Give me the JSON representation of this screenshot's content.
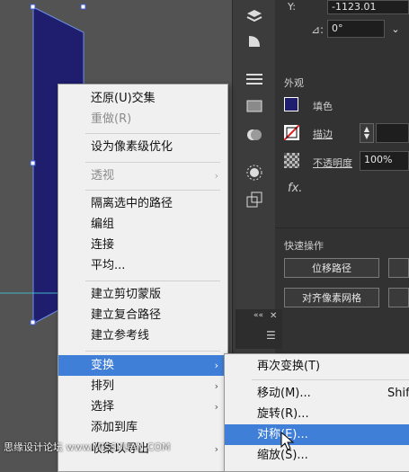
{
  "colors": {
    "menu_highlight": "#3f7fd8",
    "shape_fill": "#1f1d6e",
    "selection": "#6e8fe6"
  },
  "props": {
    "y_label": "Y:",
    "y_value": "-1123.01",
    "angle_value": "0°",
    "appearance_title": "外观",
    "fill_label": "填色",
    "stroke_label": "描边",
    "opacity_label": "不透明度",
    "opacity_value": "100%",
    "fx_label": "fx.",
    "quick_actions_title": "快速操作",
    "offset_path_button": "位移路径",
    "align_pixel_grid_button": "对齐像素网格"
  },
  "toolbar": {
    "icons": [
      "layers-icon",
      "quarter-shape-icon",
      "menu-lines-icon",
      "gradient-box-icon",
      "overlap-circles-icon",
      "sun-icon",
      "export-icon"
    ]
  },
  "mini_panel": {
    "collapse_glyph": "««",
    "close_glyph": "✕",
    "menu_glyph": "☰"
  },
  "menu": {
    "items": [
      {
        "label": "还原(U)交集"
      },
      {
        "label": "重做(R)"
      },
      {
        "label": "设为像素级优化"
      },
      {
        "label": "透视"
      },
      {
        "label": "隔离选中的路径"
      },
      {
        "label": "编组"
      },
      {
        "label": "连接"
      },
      {
        "label": "平均..."
      },
      {
        "label": "建立剪切蒙版"
      },
      {
        "label": "建立复合路径"
      },
      {
        "label": "建立参考线"
      },
      {
        "label": "变换"
      },
      {
        "label": "排列"
      },
      {
        "label": "选择"
      },
      {
        "label": "添加到库"
      },
      {
        "label": "收集以导出"
      }
    ],
    "arrow_glyph": "›"
  },
  "submenu": {
    "items": [
      {
        "label": "再次变换(T)"
      },
      {
        "label": "移动(M)..."
      },
      {
        "label": "旋转(R)..."
      },
      {
        "label": "对称(E)..."
      },
      {
        "label": "缩放(S)..."
      }
    ],
    "move_shortcut": "Shift"
  },
  "watermark": "思缘设计论坛  www.MISSYUAN.COM"
}
